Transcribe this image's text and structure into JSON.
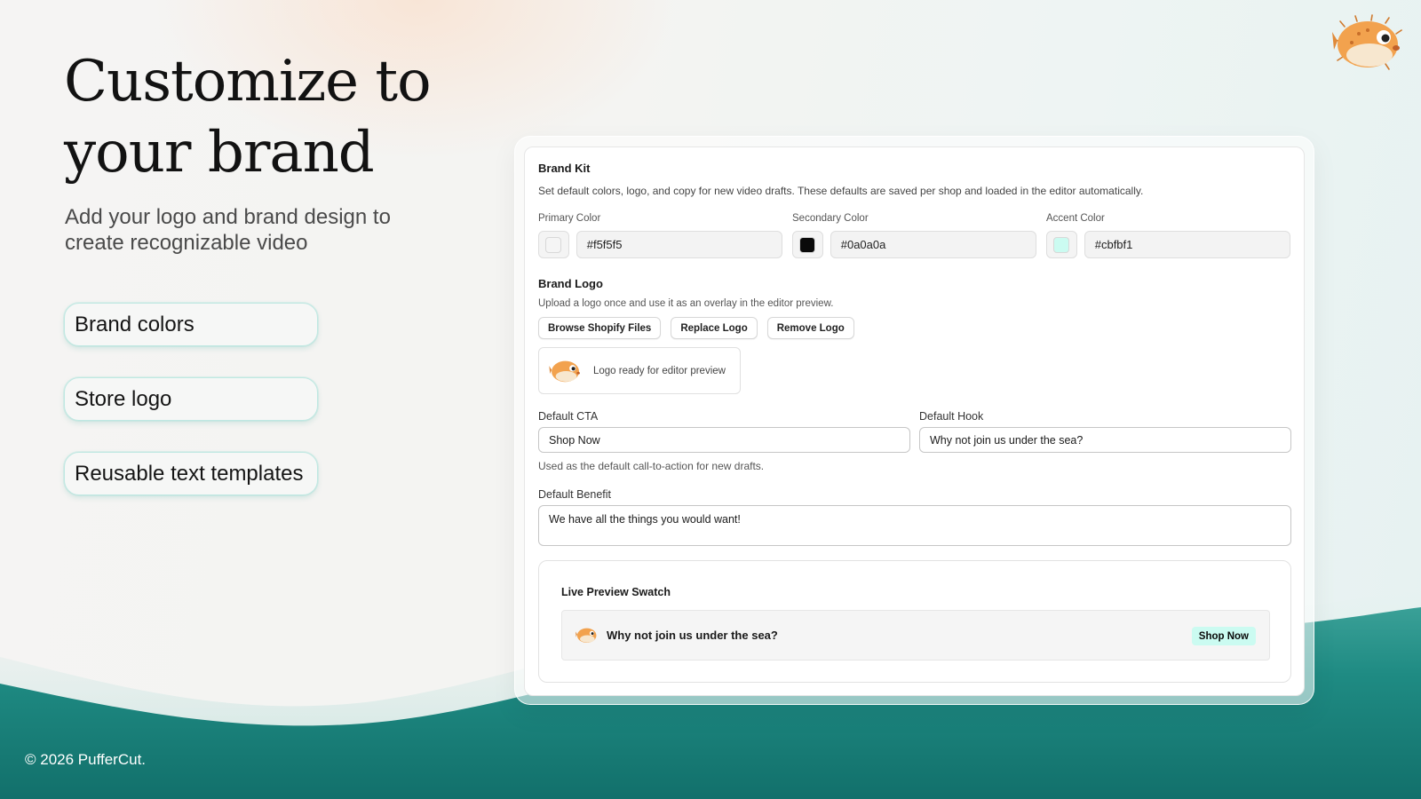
{
  "headline": "Customize to your brand",
  "subline": "Add your logo and brand design to create recognizable video",
  "features": [
    {
      "label": "Brand colors"
    },
    {
      "label": "Store logo"
    },
    {
      "label": "Reusable text templates"
    }
  ],
  "footer": {
    "copyright": "© 2026 PufferCut."
  },
  "mascot_icon": "pufferfish-icon",
  "brand_kit": {
    "title": "Brand Kit",
    "description": "Set default colors, logo, and copy for new video drafts. These defaults are saved per shop and loaded in the editor automatically.",
    "colors": [
      {
        "label": "Primary Color",
        "hex": "#f5f5f5"
      },
      {
        "label": "Secondary Color",
        "hex": "#0a0a0a"
      },
      {
        "label": "Accent Color",
        "hex": "#cbfbf1"
      }
    ],
    "logo": {
      "title": "Brand Logo",
      "description": "Upload a logo once and use it as an overlay in the editor preview.",
      "browse_label": "Browse Shopify Files",
      "replace_label": "Replace Logo",
      "remove_label": "Remove Logo",
      "status": "Logo ready for editor preview"
    },
    "cta": {
      "label": "Default CTA",
      "value": "Shop Now",
      "help": "Used as the default call-to-action for new drafts."
    },
    "hook": {
      "label": "Default Hook",
      "value": "Why not join us under the sea?"
    },
    "benefit": {
      "label": "Default Benefit",
      "value": "We have all the things you would want!"
    },
    "preview": {
      "title": "Live Preview Swatch",
      "hook": "Why not join us under the sea?",
      "cta": "Shop Now"
    }
  }
}
